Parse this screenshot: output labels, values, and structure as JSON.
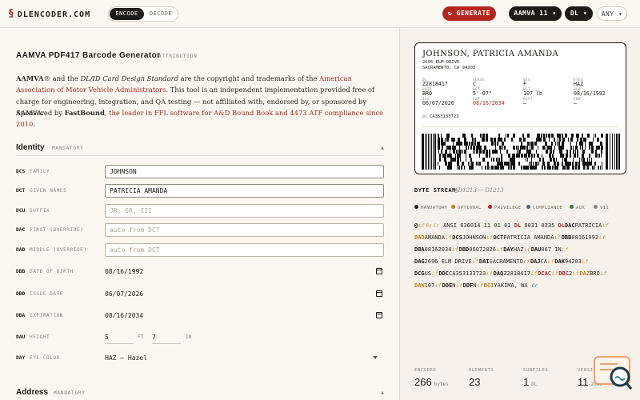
{
  "brand": {
    "mark": "§",
    "name": "DLENCODER.COM"
  },
  "mode": {
    "encode": "ENCODE",
    "decode": "DECODE"
  },
  "toolbar": {
    "generate": "↻ GENERATE",
    "standard": "AAMVA 11 ▾",
    "doc_type": "DL ▾",
    "state": "ANY ▾"
  },
  "header": {
    "title": "AAMVA PDF417 Barcode Generator",
    "tag": "ATTRIBUTION"
  },
  "intro": {
    "p1_a": "AAMVA",
    "p1_b": "® and the ",
    "p1_c": "DL/ID Card Design Standard",
    "p1_d": " are the copyright and trademarks of the ",
    "p1_link": "American Association of Motor Vehicle Administrators",
    "p1_e": ". This tool is an independent implementation provided free of charge for engineering, integration, and QA testing — not affiliated with, endorsed by, or sponsored by AAMVA.",
    "sponsor_a": "Sponsored by ",
    "sponsor_name": "FastBound",
    "sponsor_link": ", the leader in FFL software for A&D Bound Book and 4473 ATF compliance since 2010",
    "sponsor_end": "."
  },
  "sections": {
    "identity": {
      "title": "Identity",
      "tag": "MANDATORY",
      "caret": "▴"
    },
    "address": {
      "title": "Address",
      "tag": "MANDATORY",
      "caret": "▴"
    }
  },
  "fields": {
    "dcs": {
      "code": "DCS",
      "label": "FAMILY",
      "value": "JOHNSON"
    },
    "dct": {
      "code": "DCT",
      "label": "GIVEN NAMES",
      "value": "PATRICIA AMANDA"
    },
    "dcu": {
      "code": "DCU",
      "label": "SUFFIX",
      "placeholder": "JR, SR, III"
    },
    "dac": {
      "code": "DAC",
      "label": "FIRST (OVERRIDE)",
      "placeholder": "auto from DCT"
    },
    "dad": {
      "code": "DAD",
      "label": "MIDDLE (OVERRIDE)",
      "placeholder": "auto from DCT"
    },
    "dbb": {
      "code": "DBB",
      "label": "DATE OF BIRTH",
      "value": "08/16/1992"
    },
    "dbd": {
      "code": "DBD",
      "label": "ISSUE DATE",
      "value": "06/07/2026"
    },
    "dba": {
      "code": "DBA",
      "label": "EXPIRATION",
      "value": "08/16/2034"
    },
    "dau": {
      "code": "DAU",
      "label": "HEIGHT",
      "ft": "5",
      "ft_unit": "FT",
      "in": "7",
      "in_unit": "IN"
    },
    "day": {
      "code": "DAY",
      "label": "EYE COLOR",
      "value": "HAZ — Hazel"
    }
  },
  "card": {
    "name": "JOHNSON, PATRICIA AMANDA",
    "addr1": "2696 ELM DRIVE",
    "addr2": "SACRAMENTO, CA 94203",
    "labels": {
      "dl": "DL",
      "class": "CLASS",
      "sex": "SEX",
      "eyes": "EYES",
      "hair": "HAIR",
      "hgt": "HGT",
      "wgt": "WGT",
      "dob": "DOB",
      "iss": "ISS",
      "exp": "EXP",
      "rest": "REST",
      "end": "END",
      "dd": "DD"
    },
    "values": {
      "dl": "Z2818417",
      "class": "C",
      "sex": "F",
      "eyes": "HAZ",
      "hair": "BRO",
      "hgt": "5'-07\"",
      "wgt": "107 lb",
      "dob": "08/16/1992",
      "iss": "06/07/2026",
      "exp": "08/16/2034",
      "rest": "—",
      "end": "—",
      "dd": "CA353133723"
    },
    "accent": "#b3261e"
  },
  "byte_stream": {
    "title": "BYTE STREAM",
    "range": "§D1213 → D1213",
    "legend": [
      "MANDATORY",
      "OPTIONAL",
      "PRIVILEGE",
      "COMPLIANCE",
      "AUX",
      "V11"
    ],
    "legend_colors": [
      "#1d1b18",
      "#c47a1f",
      "#b3261e",
      "#3f6b8c",
      "#3d7a3a",
      "#8b857c"
    ],
    "l1": {
      "c1": "@",
      "c2": "Lf",
      "c3": "Rs",
      "c4": "Cr",
      "ansi": " ANSI ",
      "iin": "636014",
      "v": "11",
      "j": "01",
      "n": "01",
      "dl": "DL",
      "nums": "0031 0235",
      "dlc": "DL",
      "dac": "DAC",
      "dacv": "PATRICIA"
    },
    "l2": {
      "dad": "DAD",
      "dadv": "AMANDA",
      "dcs": "DCS",
      "dcsv": "JOHNSON",
      "dct": "DCT",
      "dctv": "PATRICIA AMANDA",
      "dbb": "DBB",
      "dbbv": "08161992"
    },
    "l3": {
      "dba": "DBA",
      "dbav": "08162034",
      "dbd": "DBD",
      "dbdv": "06072026",
      "day": "DAY",
      "dayv": "HAZ",
      "dau": "DAU",
      "dauv": "067 IN"
    },
    "l4": {
      "dag": "DAG",
      "dagv": "2696 ELM DRIVE",
      "dai": "DAI",
      "daiv": "SACRAMENTO",
      "daj": "DAJ",
      "dajv": "CA",
      "dak": "DAK",
      "dakv": "94203"
    },
    "l5": {
      "dcg": "DCG",
      "dcgv": "US",
      "ddc": "DDC",
      "ddcv": "CA353133723",
      "daq": "DAQ",
      "daqv": "Z2818417",
      "dca": "DCA",
      "dcav": "C",
      "dbc": "DBC",
      "dbcv": "2",
      "daz": "DAZ",
      "dazv": "BRO"
    },
    "l6": {
      "daw": "DAW",
      "dawv": "107",
      "dde": "DDE",
      "ddev": "N",
      "ddf": "DDF",
      "ddfv": "N",
      "dci": "DCI",
      "dciv": "YAKIMA, WA",
      "cr": "Cr"
    }
  },
  "stats": {
    "encoded": {
      "label": "ENCODED",
      "value": "266",
      "unit": "bytes"
    },
    "elements": {
      "label": "ELEMENTS",
      "value": "23"
    },
    "subfiles": {
      "label": "SUBFILES",
      "value": "1",
      "unit": "DL"
    },
    "version": {
      "label": "VERSION",
      "value": "11",
      "unit": "2025"
    }
  }
}
